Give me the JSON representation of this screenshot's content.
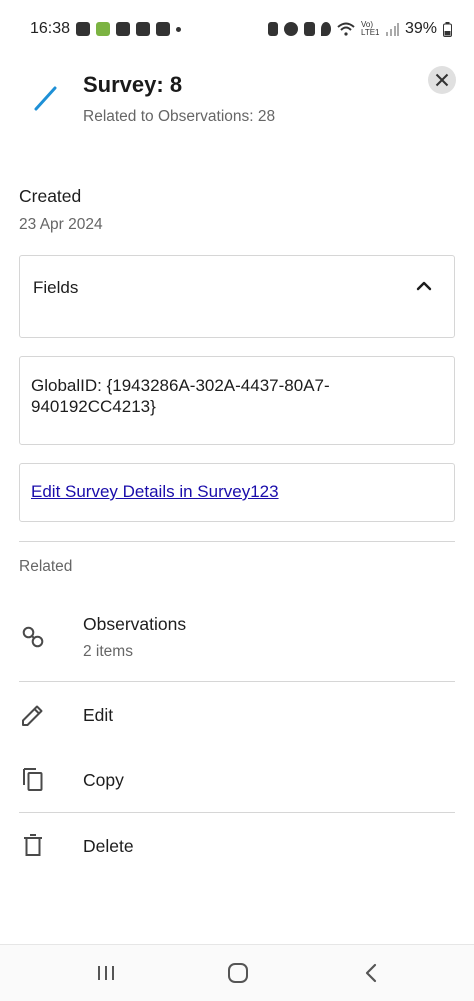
{
  "status_bar": {
    "time": "16:38",
    "battery": "39%",
    "network": "Vo) LTE1"
  },
  "header": {
    "title": "Survey: 8",
    "subtitle": "Related to Observations: 28",
    "feature_icon": "line-feature-icon",
    "close_icon": "close-icon",
    "accent_color": "#1e90d6"
  },
  "created": {
    "label": "Created",
    "value": "23 Apr 2024"
  },
  "fields_card": {
    "label": "Fields",
    "expanded": true,
    "chevron_icon": "chevron-up-icon"
  },
  "global_id": {
    "text": "GlobalID: {1943286A-302A-4437-80A7-940192CC4213}"
  },
  "link_card": {
    "text": "Edit Survey Details in Survey123",
    "color": "#1a0dab"
  },
  "related": {
    "label": "Related",
    "items": [
      {
        "title": "Observations",
        "subtitle": "2 items",
        "icon": "link-icon"
      }
    ]
  },
  "actions": [
    {
      "label": "Edit",
      "icon": "pencil-icon"
    },
    {
      "label": "Copy",
      "icon": "copy-icon"
    },
    {
      "label": "Delete",
      "icon": "trash-icon"
    }
  ],
  "nav_bar": {
    "recents_icon": "recents-icon",
    "home_icon": "home-icon",
    "back_icon": "back-icon"
  }
}
